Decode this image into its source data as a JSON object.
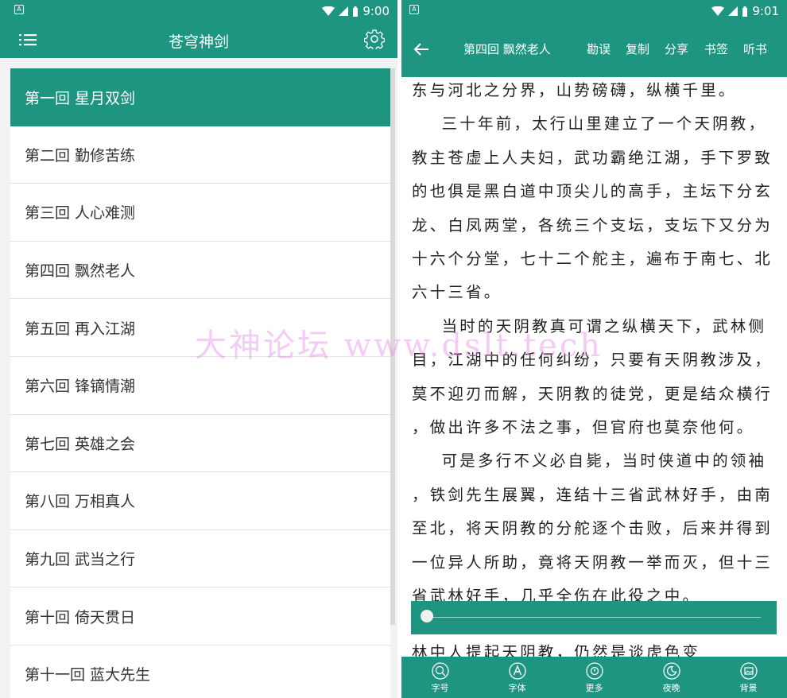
{
  "left": {
    "status": {
      "time": "9:00"
    },
    "title": "苍穹神剑",
    "chapters": [
      "第一回 星月双剑",
      "第二回 勤修苦练",
      "第三回 人心难测",
      "第四回 飘然老人",
      "第五回 再入江湖",
      "第六回 锋镝情潮",
      "第七回 英雄之会",
      "第八回 万相真人",
      "第九回 武当之行",
      "第十回 倚天贯日",
      "第十一回 蓝大先生"
    ]
  },
  "right": {
    "status": {
      "time": "9:01"
    },
    "chapter_title": "第四回 飘然老人",
    "actions": {
      "correct": "勘误",
      "copy": "复制",
      "share": "分享",
      "bookmark": "书签",
      "listen": "听书"
    },
    "content_lines": [
      "东与河北之分界，山势磅礴，纵横千里。",
      "    三十年前，太行山里建立了一个天阴教，",
      "教主苍虚上人夫妇，武功霸绝江湖，手下罗致",
      "的也俱是黑白道中顶尖儿的高手，主坛下分玄",
      "龙、白凤两堂，各统三个支坛，支坛下又分为",
      "十六个分堂，七十二个舵主，遍布于南七、北",
      "六十三省。",
      "    当时的天阴教真可谓之纵横天下，武林侧",
      "目，江湖中的任何纠纷，只要有天阴教涉及，",
      "莫不迎刃而解，天阴教的徒党，更是结众横行",
      "，做出许多不法之事，但官府也莫奈他何。",
      "    可是多行不义必自毙，当时侠道中的领袖",
      "，铁剑先生展翼，连结十三省武林好手，由南",
      "至北，将天阴教的分舵逐个击败，后来并得到",
      "一位异人所助，竟将天阴教一举而灭，但十三",
      "省武林好手，几乎全伤在此役之中。"
    ],
    "partial_line": "林中人提起天阴教，仍然是谈虎色变",
    "progress": 0.0,
    "bottom": {
      "font_size": "字号",
      "font": "字体",
      "more": "更多",
      "night": "夜晚",
      "background": "背景"
    }
  },
  "watermark": "大神论坛   www.dslt.tech",
  "colors": {
    "primary": "#1e9580"
  }
}
